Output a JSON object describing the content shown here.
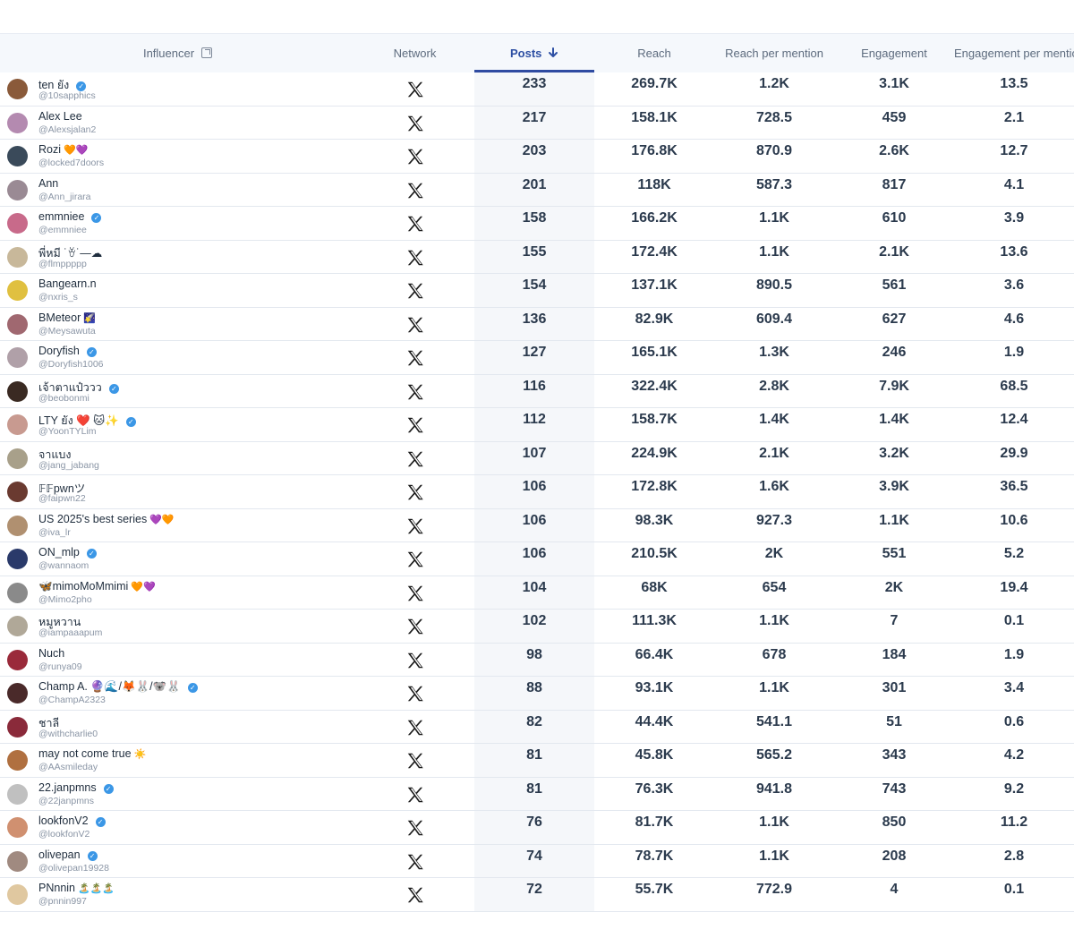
{
  "columns": {
    "influencer": "Influencer",
    "network": "Network",
    "posts": "Posts",
    "reach": "Reach",
    "reach_per_mention": "Reach per mention",
    "engagement": "Engagement",
    "engagement_per_mention": "Engagement per mention"
  },
  "sort": {
    "column": "posts",
    "direction": "descending"
  },
  "rows": [
    {
      "name": "ten ยัง",
      "handle": "@10sapphics",
      "verified": true,
      "emoji": "",
      "posts": "233",
      "reach": "269.7K",
      "rpm": "1.2K",
      "eng": "3.1K",
      "epm": "13.5",
      "avatar": "#8a5a3a"
    },
    {
      "name": "Alex Lee",
      "handle": "@Alexsjalan2",
      "verified": false,
      "emoji": "",
      "posts": "217",
      "reach": "158.1K",
      "rpm": "728.5",
      "eng": "459",
      "epm": "2.1",
      "avatar": "#b48ab0"
    },
    {
      "name": "Rozi",
      "handle": "@locked7doors",
      "verified": false,
      "emoji": "🧡💜",
      "posts": "203",
      "reach": "176.8K",
      "rpm": "870.9",
      "eng": "2.6K",
      "epm": "12.7",
      "avatar": "#3a4a5a"
    },
    {
      "name": "Ann",
      "handle": "@Ann_jirara",
      "verified": false,
      "emoji": "",
      "posts": "201",
      "reach": "118K",
      "rpm": "587.3",
      "eng": "817",
      "epm": "4.1",
      "avatar": "#9a8a94"
    },
    {
      "name": "emmniee",
      "handle": "@emmniee",
      "verified": true,
      "emoji": "",
      "posts": "158",
      "reach": "166.2K",
      "rpm": "1.1K",
      "eng": "610",
      "epm": "3.9",
      "avatar": "#c86a8a"
    },
    {
      "name": "พี่หมี ˙ꈊ˙—☁",
      "handle": "@flmppppp",
      "verified": false,
      "emoji": "",
      "posts": "155",
      "reach": "172.4K",
      "rpm": "1.1K",
      "eng": "2.1K",
      "epm": "13.6",
      "avatar": "#c8b89a"
    },
    {
      "name": "Bangearn.n",
      "handle": "@nxris_s",
      "verified": false,
      "emoji": "",
      "posts": "154",
      "reach": "137.1K",
      "rpm": "890.5",
      "eng": "561",
      "epm": "3.6",
      "avatar": "#e0c040"
    },
    {
      "name": "BMeteor",
      "handle": "@Meysawuta",
      "verified": false,
      "emoji": "🌠",
      "posts": "136",
      "reach": "82.9K",
      "rpm": "609.4",
      "eng": "627",
      "epm": "4.6",
      "avatar": "#a06870"
    },
    {
      "name": "Doryfish",
      "handle": "@Doryfish1006",
      "verified": true,
      "emoji": "",
      "posts": "127",
      "reach": "165.1K",
      "rpm": "1.3K",
      "eng": "246",
      "epm": "1.9",
      "avatar": "#b0a0a8"
    },
    {
      "name": "เจ้าตาแป๋ววว",
      "handle": "@beobonmi",
      "verified": true,
      "emoji": "",
      "posts": "116",
      "reach": "322.4K",
      "rpm": "2.8K",
      "eng": "7.9K",
      "epm": "68.5",
      "avatar": "#3a2a22"
    },
    {
      "name": "LTY ยัง ❤️ 🐱✨",
      "handle": "@YoonTYLim",
      "verified": true,
      "emoji": "",
      "posts": "112",
      "reach": "158.7K",
      "rpm": "1.4K",
      "eng": "1.4K",
      "epm": "12.4",
      "avatar": "#c89a90"
    },
    {
      "name": "จาแบง",
      "handle": "@jang_jabang",
      "verified": false,
      "emoji": "",
      "posts": "107",
      "reach": "224.9K",
      "rpm": "2.1K",
      "eng": "3.2K",
      "epm": "29.9",
      "avatar": "#a8a08a"
    },
    {
      "name": "𝔽𝔽pwnツ",
      "handle": "@faipwn22",
      "verified": false,
      "emoji": "",
      "posts": "106",
      "reach": "172.8K",
      "rpm": "1.6K",
      "eng": "3.9K",
      "epm": "36.5",
      "avatar": "#6a3a30"
    },
    {
      "name": "US 2025's best series",
      "handle": "@iva_lr",
      "verified": false,
      "emoji": "💜🧡",
      "posts": "106",
      "reach": "98.3K",
      "rpm": "927.3",
      "eng": "1.1K",
      "epm": "10.6",
      "avatar": "#b09070"
    },
    {
      "name": "ON_mlp",
      "handle": "@wannaom",
      "verified": true,
      "emoji": "",
      "posts": "106",
      "reach": "210.5K",
      "rpm": "2K",
      "eng": "551",
      "epm": "5.2",
      "avatar": "#2a3a6a"
    },
    {
      "name": "🦋mimoMoMmimi",
      "handle": "@Mimo2pho",
      "verified": false,
      "emoji": "🧡💜",
      "posts": "104",
      "reach": "68K",
      "rpm": "654",
      "eng": "2K",
      "epm": "19.4",
      "avatar": "#8a8a8a"
    },
    {
      "name": "หมูหวาน",
      "handle": "@iampaaapum",
      "verified": false,
      "emoji": "",
      "posts": "102",
      "reach": "111.3K",
      "rpm": "1.1K",
      "eng": "7",
      "epm": "0.1",
      "avatar": "#b0a898"
    },
    {
      "name": "Nuch",
      "handle": "@runya09",
      "verified": false,
      "emoji": "",
      "posts": "98",
      "reach": "66.4K",
      "rpm": "678",
      "eng": "184",
      "epm": "1.9",
      "avatar": "#9a2a3a"
    },
    {
      "name": "Champ A. 🔮🌊/🦊🐰/🐨🐰",
      "handle": "@ChampA2323",
      "verified": true,
      "emoji": "",
      "posts": "88",
      "reach": "93.1K",
      "rpm": "1.1K",
      "eng": "301",
      "epm": "3.4",
      "avatar": "#4a2a2a"
    },
    {
      "name": "ชาลี",
      "handle": "@withcharlie0",
      "verified": false,
      "emoji": "",
      "posts": "82",
      "reach": "44.4K",
      "rpm": "541.1",
      "eng": "51",
      "epm": "0.6",
      "avatar": "#8a2a3a"
    },
    {
      "name": "may not come true",
      "handle": "@AAsmileday",
      "verified": false,
      "emoji": "☀️",
      "posts": "81",
      "reach": "45.8K",
      "rpm": "565.2",
      "eng": "343",
      "epm": "4.2",
      "avatar": "#b07040"
    },
    {
      "name": "22.janpmns",
      "handle": "@22janpmns",
      "verified": true,
      "emoji": "",
      "posts": "81",
      "reach": "76.3K",
      "rpm": "941.8",
      "eng": "743",
      "epm": "9.2",
      "avatar": "#c0c0c0"
    },
    {
      "name": "lookfonV2",
      "handle": "@lookfonV2",
      "verified": true,
      "emoji": "",
      "posts": "76",
      "reach": "81.7K",
      "rpm": "1.1K",
      "eng": "850",
      "epm": "11.2",
      "avatar": "#d09070"
    },
    {
      "name": "olivepan",
      "handle": "@olivepan19928",
      "verified": true,
      "emoji": "",
      "posts": "74",
      "reach": "78.7K",
      "rpm": "1.1K",
      "eng": "208",
      "epm": "2.8",
      "avatar": "#a08a80"
    },
    {
      "name": "PNnnin",
      "handle": "@pnnin997",
      "verified": false,
      "emoji": "🏝️🏝️🏝️",
      "posts": "72",
      "reach": "55.7K",
      "rpm": "772.9",
      "eng": "4",
      "epm": "0.1",
      "avatar": "#e0c8a0"
    }
  ],
  "icons": {
    "network": "x-logo-icon",
    "verified": "verified-badge-icon",
    "sort": "arrow-down-icon",
    "external": "external-link-icon"
  }
}
